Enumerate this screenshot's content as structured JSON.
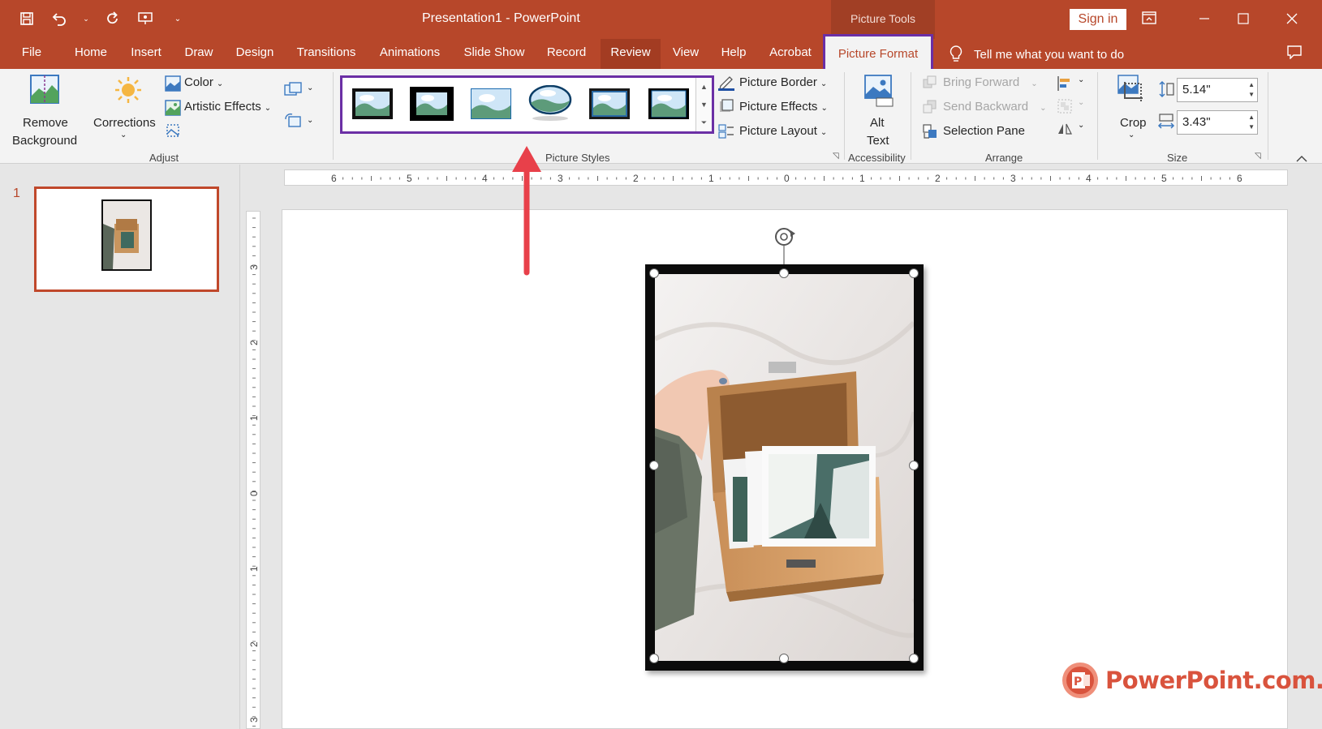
{
  "window": {
    "title": "Presentation1  -  PowerPoint",
    "context_group": "Picture Tools",
    "sign_in": "Sign in"
  },
  "qat": {
    "icons": [
      "save-icon",
      "undo-icon",
      "redo-icon",
      "present-icon",
      "customize-icon"
    ]
  },
  "tabs": [
    {
      "label": "File"
    },
    {
      "label": "Home"
    },
    {
      "label": "Insert"
    },
    {
      "label": "Draw"
    },
    {
      "label": "Design"
    },
    {
      "label": "Transitions"
    },
    {
      "label": "Animations"
    },
    {
      "label": "Slide Show"
    },
    {
      "label": "Record"
    },
    {
      "label": "Review"
    },
    {
      "label": "View"
    },
    {
      "label": "Help"
    },
    {
      "label": "Acrobat"
    },
    {
      "label": "Picture Format"
    }
  ],
  "tell_me": "Tell me what you want to do",
  "ribbon": {
    "adjust": {
      "remove_bg_1": "Remove",
      "remove_bg_2": "Background",
      "corrections": "Corrections",
      "color": "Color",
      "artistic": "Artistic Effects",
      "group": "Adjust"
    },
    "styles": {
      "border": "Picture Border",
      "effects": "Picture Effects",
      "layout": "Picture Layout",
      "group": "Picture Styles"
    },
    "accessibility": {
      "alt_1": "Alt",
      "alt_2": "Text",
      "group": "Accessibility"
    },
    "arrange": {
      "bring_forward": "Bring Forward",
      "send_backward": "Send Backward",
      "selection_pane": "Selection Pane",
      "group": "Arrange"
    },
    "size": {
      "crop": "Crop",
      "height": "5.14\"",
      "width": "3.43\"",
      "group": "Size"
    }
  },
  "slides": {
    "number": "1"
  },
  "ruler": {
    "top_labels": [
      "6",
      "5",
      "4",
      "3",
      "2",
      "1",
      "0",
      "1",
      "2",
      "3",
      "4",
      "5",
      "6"
    ],
    "left_labels": [
      "3",
      "2",
      "1",
      "0",
      "1",
      "2",
      "3"
    ]
  },
  "watermark": {
    "text": "PowerPoint.com.vn"
  },
  "colors": {
    "accent": "#b7472a",
    "highlight": "#6b2fa5",
    "arrow": "#e8404a"
  }
}
